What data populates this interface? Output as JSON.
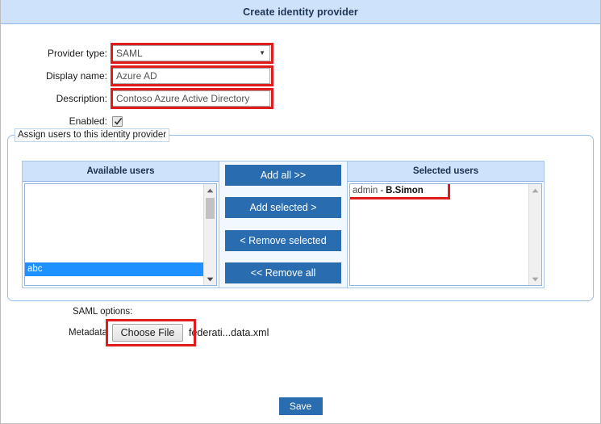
{
  "window": {
    "title": "Create identity provider",
    "title_bg": "#cfe2fb",
    "accent": "#2a6cb0",
    "annotation_color": "#e01b1b"
  },
  "form": {
    "provider_type": {
      "label": "Provider type:",
      "value": "SAML",
      "dropdown_glyph": "▼"
    },
    "display_name": {
      "label": "Display name:",
      "value": "Azure AD",
      "placeholder": ""
    },
    "description": {
      "label": "Description:",
      "value": "Contoso Azure Active Directory",
      "placeholder": ""
    },
    "enabled": {
      "label": "Enabled:",
      "checked": true
    }
  },
  "assign_users": {
    "legend": "Assign users to this identity provider",
    "available": {
      "header": "Available users",
      "items": [
        {
          "text": "abc",
          "selected": true
        }
      ]
    },
    "selected": {
      "header": "Selected users",
      "items": [
        {
          "login": "admin",
          "separator": "-",
          "name": "B.Simon",
          "selected": false
        }
      ]
    },
    "buttons": [
      {
        "label": "Add all >>",
        "name": "add-all-button"
      },
      {
        "label": "Add selected >",
        "name": "add-selected-button"
      },
      {
        "label": "< Remove selected",
        "name": "remove-selected-button"
      },
      {
        "label": "<< Remove all",
        "name": "remove-all-button"
      }
    ]
  },
  "saml_options": {
    "section_label": "SAML options:",
    "metadata_label": "Metadata",
    "choose_file_label": "Choose File",
    "file_name": "federati...data.xml"
  },
  "footer": {
    "save_label": "Save"
  }
}
